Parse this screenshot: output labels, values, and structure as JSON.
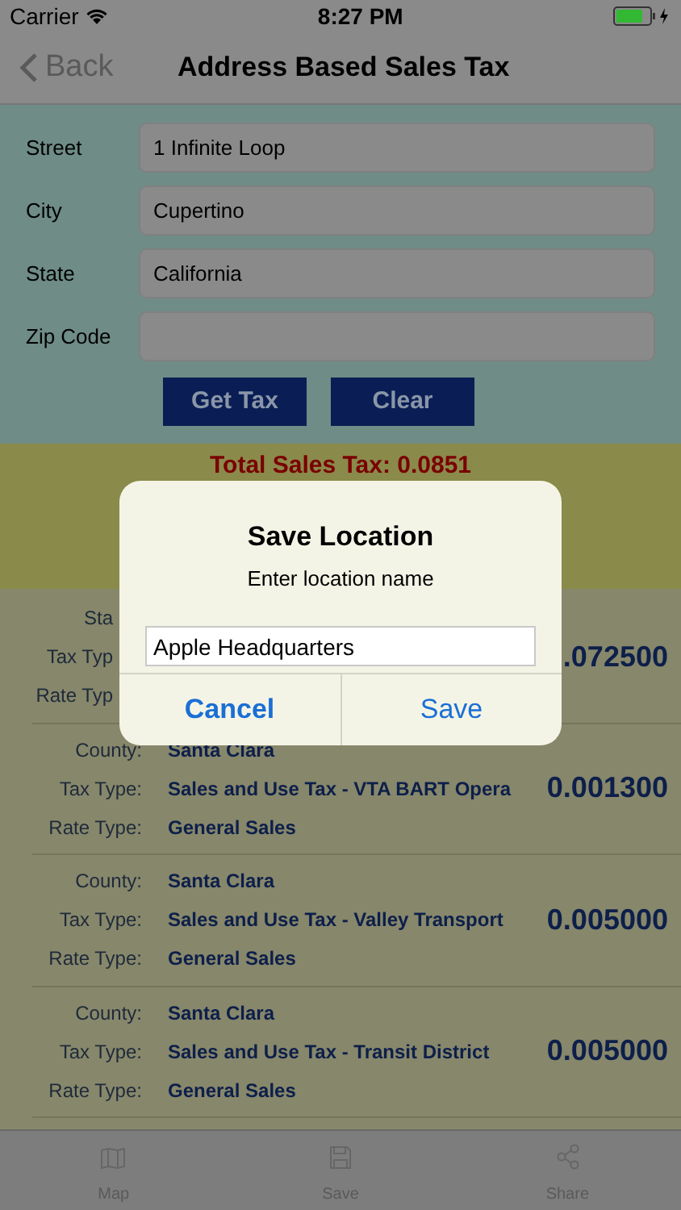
{
  "status_bar": {
    "carrier": "Carrier",
    "time": "8:27 PM"
  },
  "nav": {
    "back": "Back",
    "title": "Address Based Sales Tax"
  },
  "form": {
    "fields": [
      {
        "label": "Street",
        "value": "1 Infinite Loop"
      },
      {
        "label": "City",
        "value": "Cupertino"
      },
      {
        "label": "State",
        "value": "California"
      },
      {
        "label": "Zip Code"
      }
    ],
    "buttons": [
      "Get Tax",
      "Clear"
    ]
  },
  "total": "Total Sales Tax: 0.0851",
  "rates": [
    {
      "kind": "covered",
      "lines": [
        {
          "label": "Sta"
        },
        {
          "label": "Tax Typ"
        },
        {
          "label": "Rate Typ"
        }
      ],
      "rate": ".072500"
    },
    {
      "lines": [
        {
          "label": "County:",
          "value": "Santa Clara"
        },
        {
          "label": "Tax Type:",
          "value": "Sales and Use Tax - VTA BART Opera"
        },
        {
          "label": "Rate Type:",
          "value": "General Sales"
        }
      ],
      "rate": "0.001300"
    },
    {
      "lines": [
        {
          "label": "County:",
          "value": "Santa Clara"
        },
        {
          "label": "Tax Type:",
          "value": "Sales and Use Tax - Valley Transport"
        },
        {
          "label": "Rate Type:",
          "value": "General Sales"
        }
      ],
      "rate": "0.005000"
    },
    {
      "lines": [
        {
          "label": "County:",
          "value": "Santa Clara"
        },
        {
          "label": "Tax Type:",
          "value": "Sales and Use Tax - Transit District"
        },
        {
          "label": "Rate Type:",
          "value": "General Sales"
        }
      ],
      "rate": "0.005000"
    }
  ],
  "tab_bar": [
    {
      "kind": "map",
      "label": "Map"
    },
    {
      "kind": "save",
      "label": "Save"
    },
    {
      "kind": "share",
      "label": "Share"
    }
  ],
  "dialog": {
    "title": "Save Location",
    "message": "Enter location name",
    "value": "Apple Headquarters",
    "buttons": [
      "Cancel",
      "Save"
    ]
  }
}
